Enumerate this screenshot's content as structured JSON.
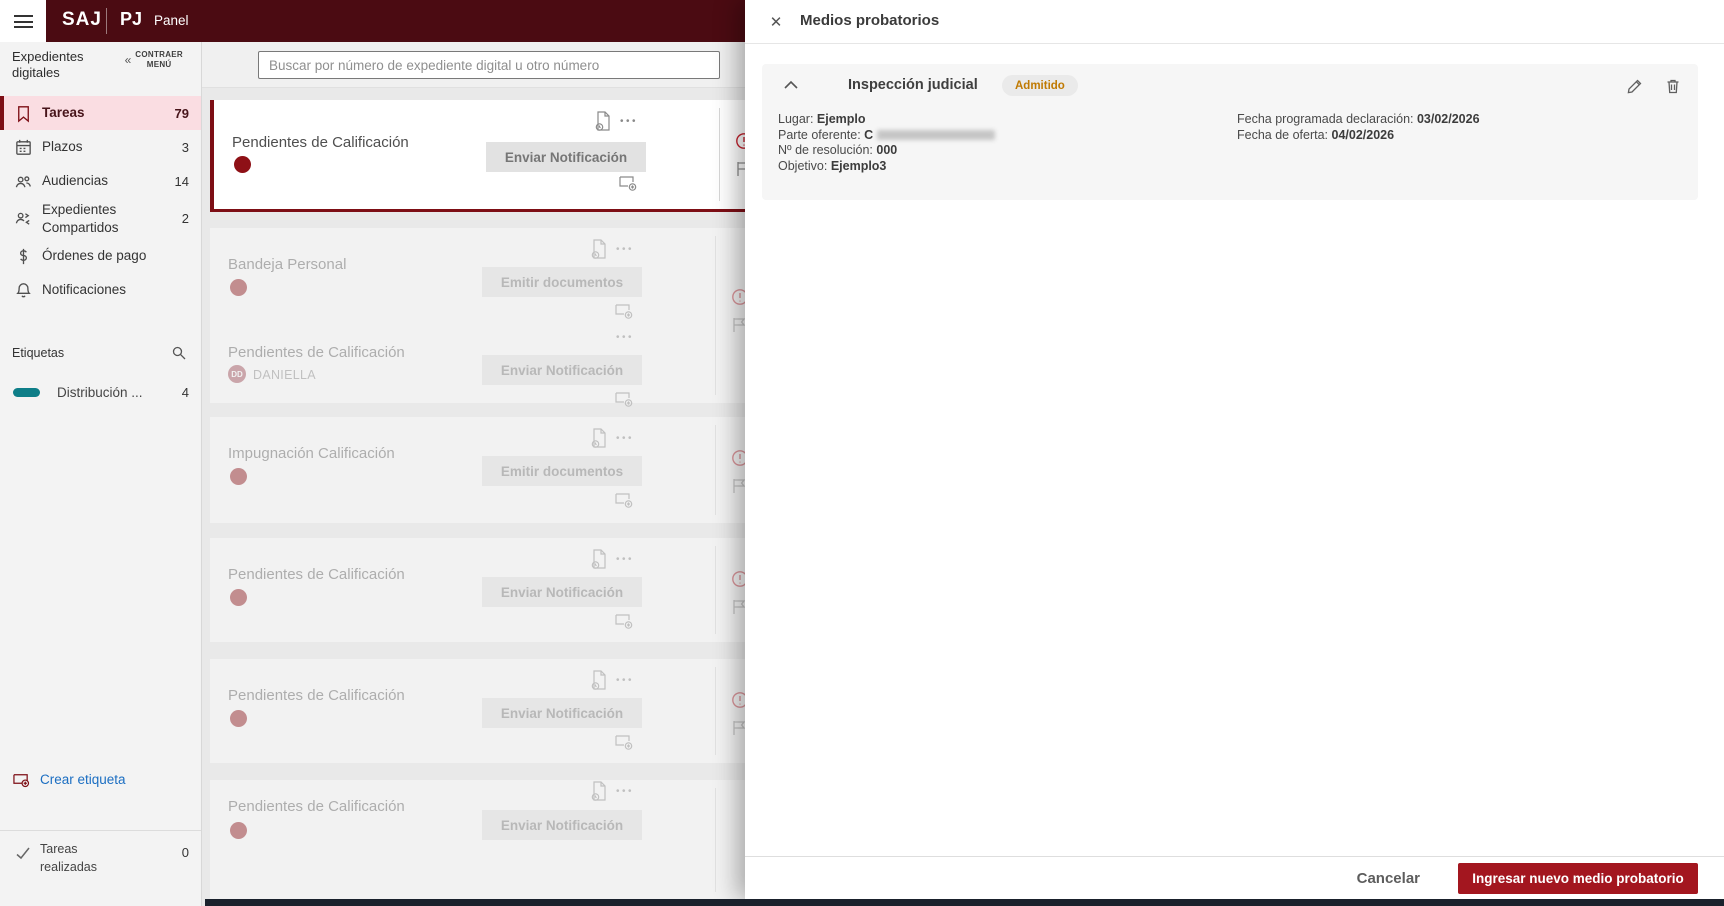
{
  "header": {
    "app_logo": "SAJ",
    "brand": "PJ",
    "page_title": "Panel"
  },
  "sidebar": {
    "section_title": "Expedientes digitales",
    "collapse_label": "CONTRAER MENÚ",
    "collapse_chevron": "«",
    "items": [
      {
        "label": "Tareas",
        "count": "79",
        "icon": "bookmark-icon",
        "active": true
      },
      {
        "label": "Plazos",
        "count": "3",
        "icon": "calendar-icon"
      },
      {
        "label": "Audiencias",
        "count": "14",
        "icon": "people-icon"
      },
      {
        "label": "Expedientes Compartidos",
        "count": "2",
        "icon": "shared-people-icon"
      },
      {
        "label": "Órdenes de pago",
        "count": "",
        "icon": "dollar-icon"
      },
      {
        "label": "Notificaciones",
        "count": "",
        "icon": "bell-icon"
      }
    ],
    "tags_section": {
      "title": "Etiquetas",
      "tags": [
        {
          "label": "Distribución ...",
          "count": "4",
          "color": "#0e7e88"
        }
      ]
    },
    "create_tag_label": "Crear etiqueta",
    "done_tasks": {
      "label": "Tareas realizadas",
      "count": "0"
    }
  },
  "search": {
    "placeholder": "Buscar por número de expediente digital u otro número"
  },
  "tasks": [
    {
      "title": "Pendientes de Calificación",
      "button": "Enviar Notificación",
      "active": true
    },
    {
      "title": "Bandeja Personal",
      "button": "Emitir documentos"
    },
    {
      "title": "Pendientes de Calificación",
      "button": "Enviar Notificación",
      "assignee": {
        "initials": "DD",
        "name": "DANIELLA"
      }
    },
    {
      "title": "Impugnación Calificación",
      "button": "Emitir documentos"
    },
    {
      "title": "Pendientes de Calificación",
      "button": "Enviar Notificación"
    },
    {
      "title": "Pendientes de Calificación",
      "button": "Enviar Notificación"
    },
    {
      "title": "Pendientes de Calificación",
      "button": "Enviar Notificación"
    }
  ],
  "modal": {
    "title": "Medios probatorios",
    "close_glyph": "✕",
    "evidence": {
      "title": "Inspección judicial",
      "status_badge": "Admitido",
      "fields_left": [
        {
          "label": "Lugar: ",
          "value": "Ejemplo"
        },
        {
          "label": "Parte oferente: ",
          "value": "C",
          "redacted": true
        },
        {
          "label": "Nº de resolución: ",
          "value": "000"
        },
        {
          "label": "Objetivo: ",
          "value": "Ejemplo3"
        }
      ],
      "fields_right": [
        {
          "label": "Fecha programada declaración: ",
          "value": "03/02/2026"
        },
        {
          "label": "Fecha de oferta: ",
          "value": "04/02/2026"
        }
      ]
    },
    "footer": {
      "cancel_label": "Cancelar",
      "primary_label": "Ingresar nuevo medio probatorio"
    }
  },
  "icons": {
    "ellipsis": "•••",
    "alert": "exclamation-circle",
    "colors": {
      "header_maroon": "#4b0b12",
      "accent_red": "#8e1016",
      "primary_button": "#a3161f",
      "active_row_bg": "#fadde2",
      "admitido_text": "#c07a02",
      "tag_teal": "#0e7e88",
      "link_blue": "#1b6ec2"
    }
  }
}
